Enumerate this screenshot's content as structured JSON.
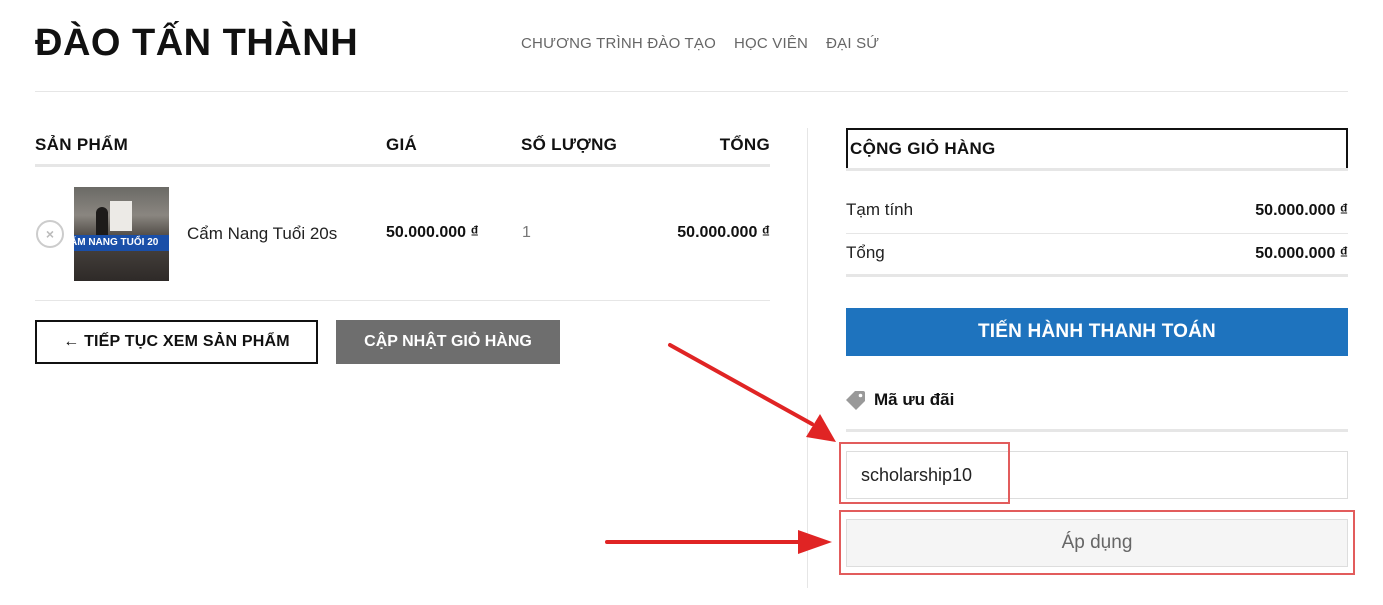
{
  "site": {
    "logo": "ĐÀO TẤN THÀNH"
  },
  "nav": {
    "items": [
      "CHƯƠNG TRÌNH ĐÀO TẠO",
      "HỌC VIÊN",
      "ĐẠI SỨ"
    ]
  },
  "cart": {
    "headers": {
      "product": "SẢN PHẨM",
      "price": "GIÁ",
      "quantity": "SỐ LƯỢNG",
      "total": "TỔNG"
    },
    "items": [
      {
        "remove_icon": "×",
        "thumb_text": "ẨM NANG TUỔI 20",
        "name": "Cẩm Nang Tuổi 20s",
        "price": "50.000.000 ₫",
        "quantity": "1",
        "total": "50.000.000 ₫"
      }
    ],
    "continue_label": "← TIẾP TỤC XEM SẢN PHẨM",
    "update_label": "CẬP NHẬT GIỎ HÀNG"
  },
  "totals": {
    "title": "CỘNG GIỎ HÀNG",
    "subtotal_label": "Tạm tính",
    "subtotal_value": "50.000.000 ₫",
    "total_label": "Tổng",
    "total_value": "50.000.000 ₫",
    "checkout_label": "TIẾN HÀNH THANH TOÁN"
  },
  "coupon": {
    "icon": "tag-icon",
    "title": "Mã ưu đãi",
    "value": "scholarship10",
    "apply_label": "Áp dụng"
  },
  "colors": {
    "accent": "#1e73be",
    "annotation": "#e02424",
    "highlight_box": "#e25c5c",
    "update_button": "#6e6e6e"
  }
}
